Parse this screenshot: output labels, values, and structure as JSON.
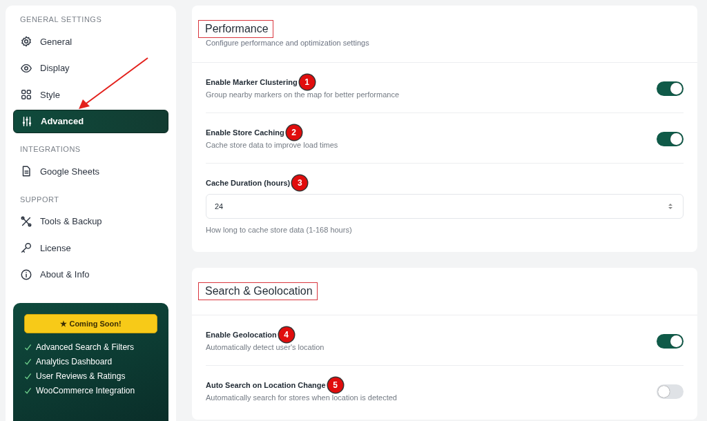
{
  "sidebar": {
    "sections": [
      {
        "heading": "GENERAL SETTINGS",
        "items": [
          {
            "label": "General",
            "selected": false
          },
          {
            "label": "Display",
            "selected": false
          },
          {
            "label": "Style",
            "selected": false
          },
          {
            "label": "Advanced",
            "selected": true
          }
        ]
      },
      {
        "heading": "INTEGRATIONS",
        "items": [
          {
            "label": "Google Sheets",
            "selected": false
          }
        ]
      },
      {
        "heading": "SUPPORT",
        "items": [
          {
            "label": "Tools & Backup",
            "selected": false
          },
          {
            "label": "License",
            "selected": false
          },
          {
            "label": "About & Info",
            "selected": false
          }
        ]
      }
    ],
    "promo": {
      "button": "★ Coming Soon!",
      "features": [
        "Advanced Search & Filters",
        "Analytics Dashboard",
        "User Reviews & Ratings",
        "WooCommerce Integration"
      ]
    }
  },
  "panels": [
    {
      "title": "Performance",
      "highlighted": true,
      "subtitle": "Configure performance and optimization settings",
      "settings": [
        {
          "kind": "toggle",
          "label": "Enable Marker Clustering",
          "badge": "1",
          "description": "Group nearby markers on the map for better performance",
          "on": true
        },
        {
          "kind": "toggle",
          "label": "Enable Store Caching",
          "badge": "2",
          "description": "Cache store data to improve load times",
          "on": true
        },
        {
          "kind": "number",
          "label": "Cache Duration (hours)",
          "badge": "3",
          "value": "24",
          "description": "How long to cache store data (1-168 hours)"
        }
      ]
    },
    {
      "title": "Search & Geolocation",
      "highlighted": true,
      "settings": [
        {
          "kind": "toggle",
          "label": "Enable Geolocation",
          "badge": "4",
          "description": "Automatically detect user's location",
          "on": true
        },
        {
          "kind": "toggle",
          "label": "Auto Search on Location Change",
          "badge": "5",
          "description": "Automatically search for stores when location is detected",
          "on": false
        }
      ]
    }
  ]
}
